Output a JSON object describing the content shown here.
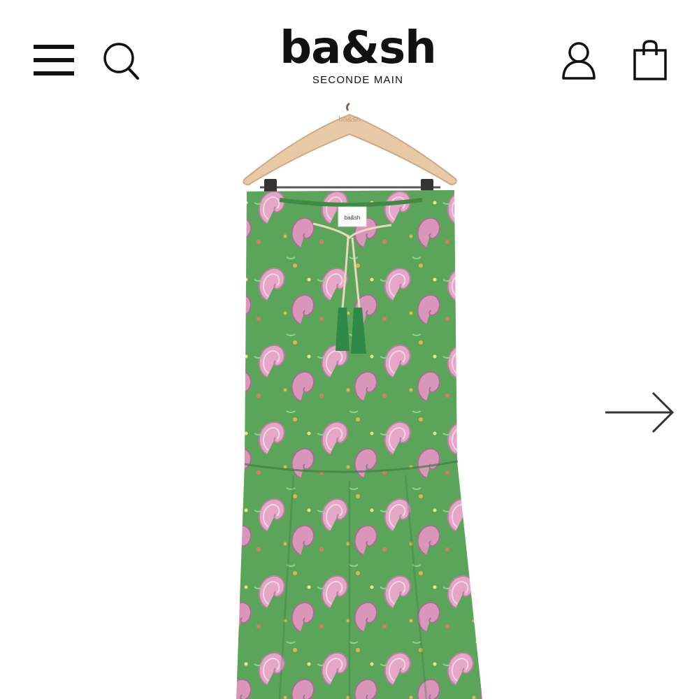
{
  "header": {
    "menu_icon": "hamburger-menu-icon",
    "search_icon": "search-icon",
    "account_icon": "user-account-icon",
    "cart_icon": "shopping-bag-icon",
    "brand": {
      "name": "ba&sh",
      "subtitle": "SECONDE MAIN"
    }
  },
  "gallery": {
    "image_subject": "green and pink paisley print long skirt on wooden hanger",
    "hanger_stamp": "ba&sh",
    "garment_label": "ba&sh",
    "next_icon": "arrow-right-icon"
  },
  "colors": {
    "text": "#111111",
    "garment_green": "#5aa55a",
    "paisley_pink": "#e6a6c8",
    "hanger_wood": "#e8c9a6"
  }
}
